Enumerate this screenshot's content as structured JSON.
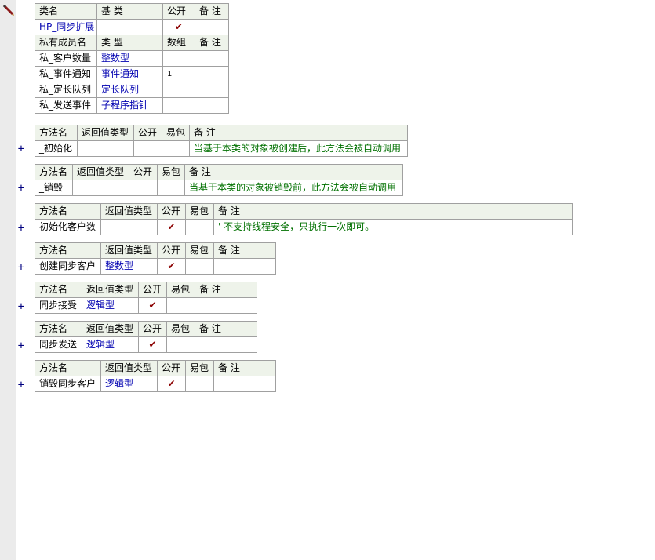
{
  "class_table": {
    "headers": [
      "类名",
      "基 类",
      "公开",
      "备 注"
    ],
    "row": {
      "name": "HP_同步扩展",
      "base": "",
      "public": "✔",
      "note": ""
    }
  },
  "members_table": {
    "headers": [
      "私有成员名",
      "类 型",
      "数组",
      "备 注"
    ],
    "rows": [
      {
        "name": "私_客户数量",
        "type": "整数型",
        "array": "",
        "note": ""
      },
      {
        "name": "私_事件通知",
        "type": "事件通知",
        "array": "1",
        "note": ""
      },
      {
        "name": "私_定长队列",
        "type": "定长队列",
        "array": "",
        "note": ""
      },
      {
        "name": "私_发送事件",
        "type": "子程序指针",
        "array": "",
        "note": ""
      }
    ]
  },
  "method_headers": [
    "方法名",
    "返回值类型",
    "公开",
    "易包",
    "备 注"
  ],
  "expand_symbol": "+",
  "methods": [
    {
      "name": "_初始化",
      "return_type": "",
      "public": "",
      "easy": "",
      "note": "当基于本类的对象被创建后，此方法会被自动调用"
    },
    {
      "name": "_销毁",
      "return_type": "",
      "public": "",
      "easy": "",
      "note": "当基于本类的对象被销毁前，此方法会被自动调用"
    },
    {
      "name": "初始化客户数",
      "return_type": "",
      "public": "✔",
      "easy": "",
      "note": "' 不支持线程安全，只执行一次即可。"
    },
    {
      "name": "创建同步客户",
      "return_type": "整数型",
      "public": "✔",
      "easy": "",
      "note": ""
    },
    {
      "name": "同步接受",
      "return_type": "逻辑型",
      "public": "✔",
      "easy": "",
      "note": ""
    },
    {
      "name": "同步发送",
      "return_type": "逻辑型",
      "public": "✔",
      "easy": "",
      "note": ""
    },
    {
      "name": "销毁同步客户",
      "return_type": "逻辑型",
      "public": "✔",
      "easy": "",
      "note": ""
    }
  ],
  "icons": {
    "pencil": "pencil-icon",
    "check": "check-icon",
    "expand": "plus-icon"
  }
}
